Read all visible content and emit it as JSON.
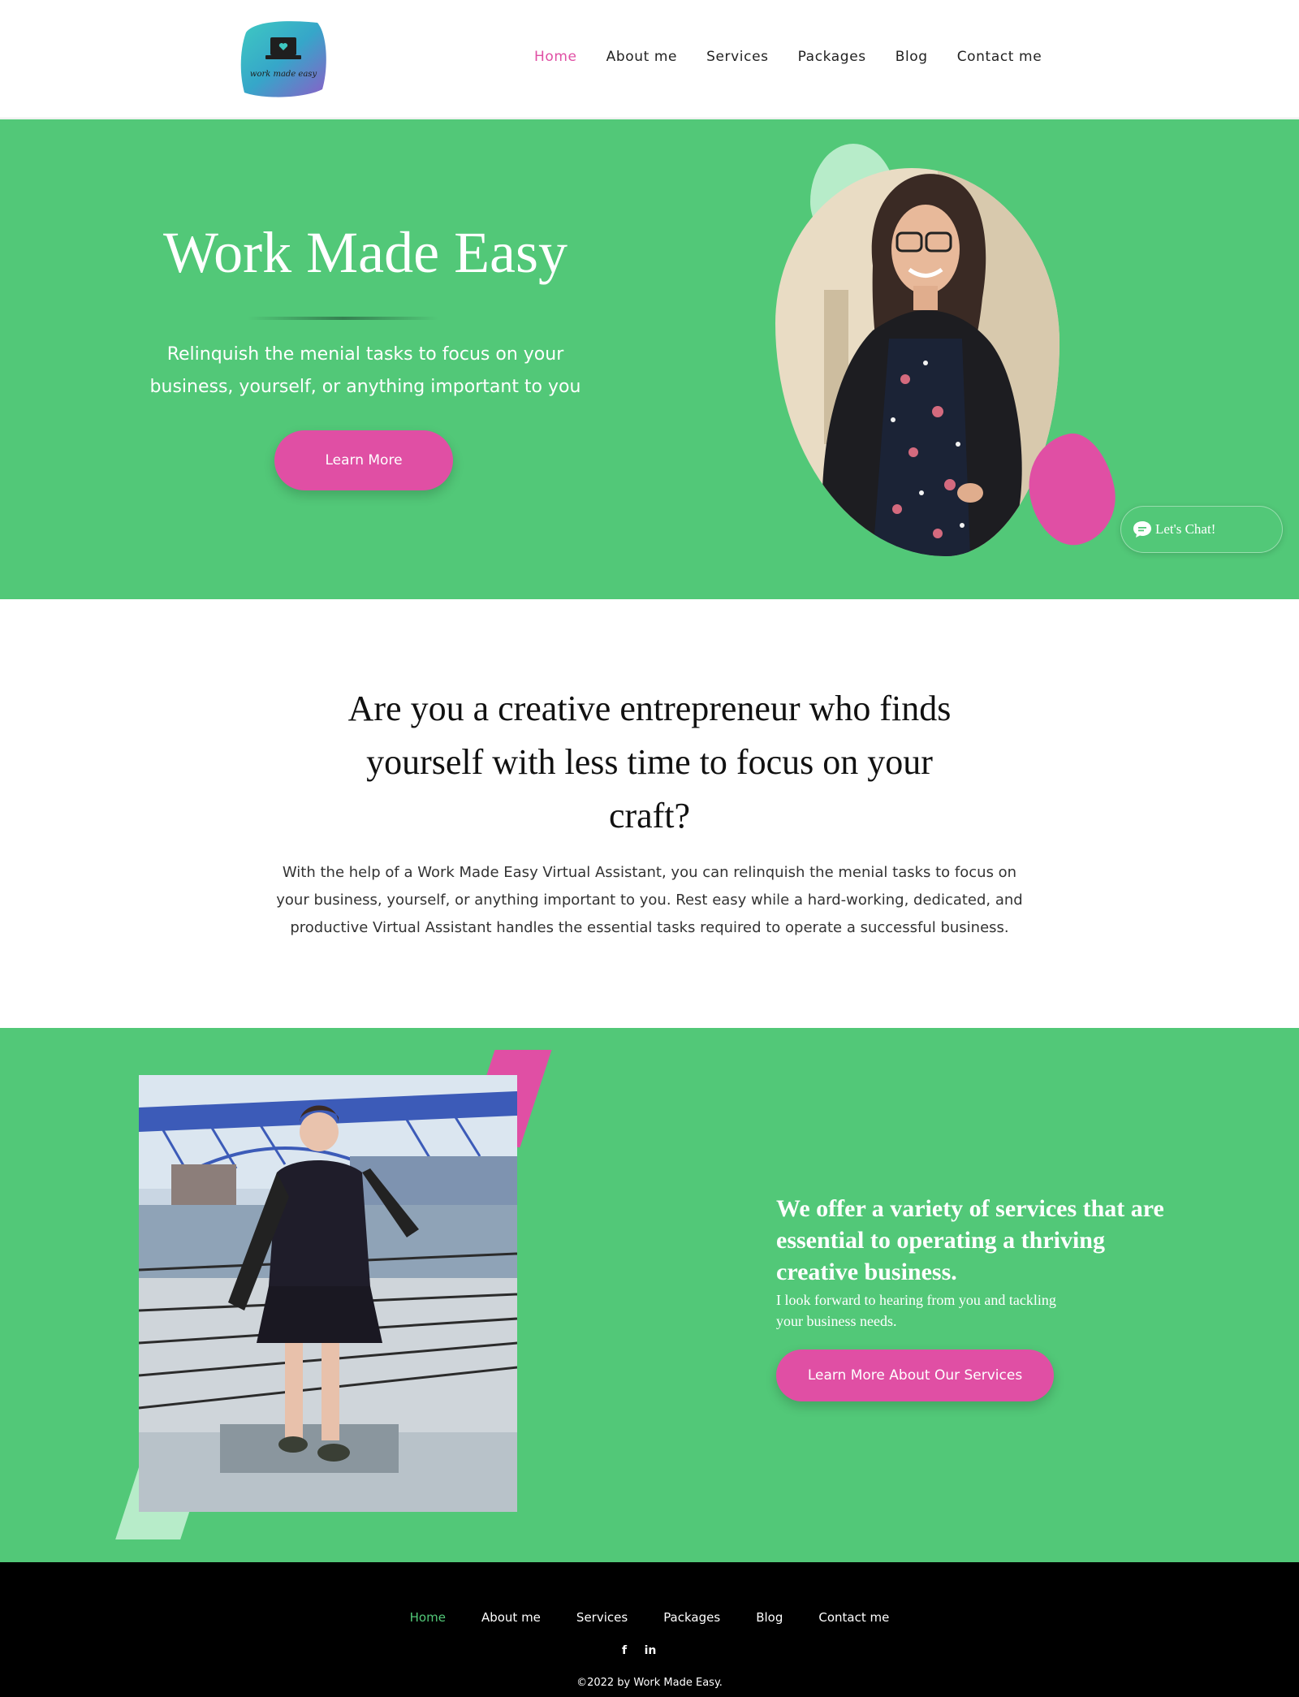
{
  "header": {
    "logo_text": "work made easy",
    "nav": [
      {
        "label": "Home",
        "active": true
      },
      {
        "label": "About me",
        "active": false
      },
      {
        "label": "Services",
        "active": false
      },
      {
        "label": "Packages",
        "active": false
      },
      {
        "label": "Blog",
        "active": false
      },
      {
        "label": "Contact me",
        "active": false
      }
    ]
  },
  "hero": {
    "title": "Work Made Easy",
    "subtitle_line1": "Relinquish the menial tasks to focus on your",
    "subtitle_line2": "business, yourself, or anything important to you",
    "button_label": "Learn More",
    "photo_alt": "woman-in-leather-jacket-photo"
  },
  "chat": {
    "label": "Let's Chat!",
    "icon": "chat-bubble-icon"
  },
  "intro": {
    "title_line1": "Are you a creative entrepreneur who finds",
    "title_line2": "yourself with less time to focus on your",
    "title_line3": "craft?",
    "body_line1": "With the help of a Work Made Easy Virtual Assistant, you can relinquish the menial tasks to focus on",
    "body_line2": "your business, yourself, or anything important to you. Rest easy while a hard-working, dedicated, and",
    "body_line3": "productive Virtual Assistant handles the essential tasks required to operate a successful business."
  },
  "services": {
    "heading_line1": "We offer a variety of services that are",
    "heading_line2": "essential to operating a thriving",
    "heading_line3": "creative business.",
    "sub_line1": "I look forward to hearing from you and tackling",
    "sub_line2": "your business needs.",
    "button_label": "Learn More About Our Services",
    "photo_alt": "woman-by-bridge-photo"
  },
  "footer": {
    "nav": [
      {
        "label": "Home",
        "active": true
      },
      {
        "label": "About me",
        "active": false
      },
      {
        "label": "Services",
        "active": false
      },
      {
        "label": "Packages",
        "active": false
      },
      {
        "label": "Blog",
        "active": false
      },
      {
        "label": "Contact me",
        "active": false
      }
    ],
    "social": [
      {
        "icon": "facebook-icon",
        "glyph": "f"
      },
      {
        "icon": "linkedin-icon",
        "glyph": "in"
      }
    ],
    "copyright": "©2022 by Work Made Easy."
  },
  "colors": {
    "brand_green": "#52c878",
    "brand_pink": "#e04fa4",
    "mint": "#b7ecc9"
  }
}
